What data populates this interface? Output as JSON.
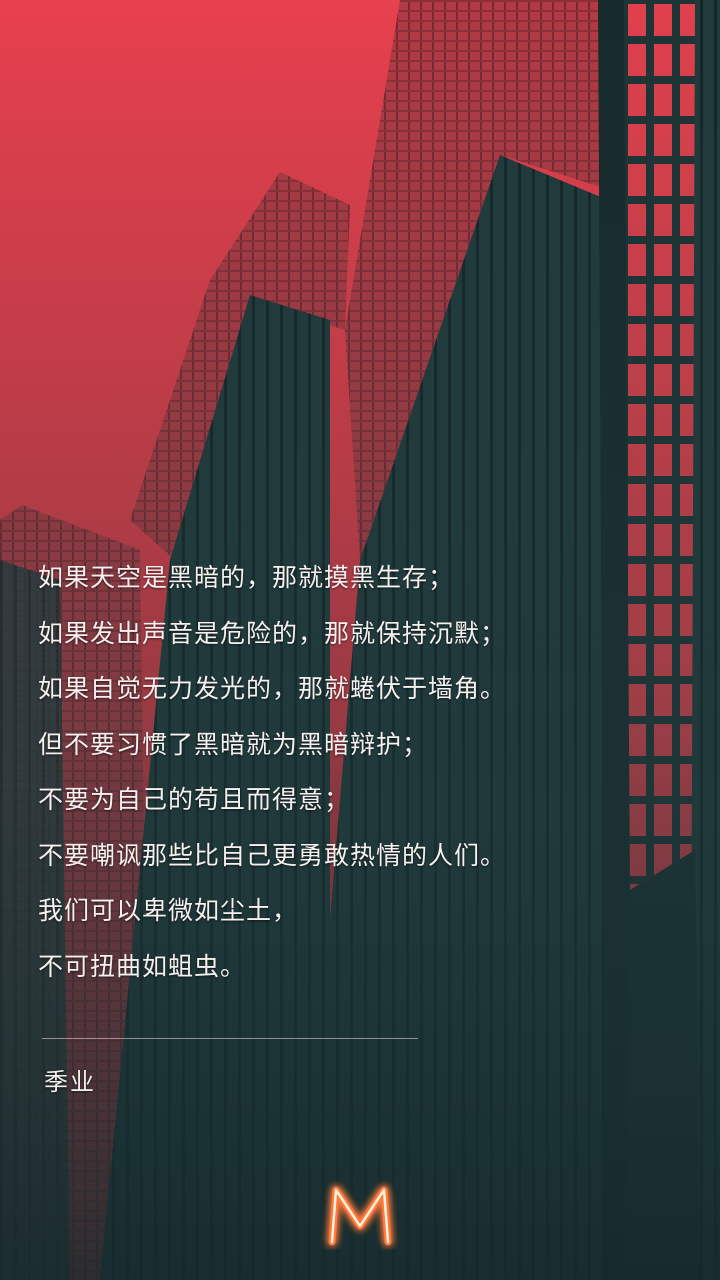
{
  "poem": {
    "lines": [
      "如果天空是黑暗的，那就摸黑生存；",
      "如果发出声音是危险的，那就保持沉默；",
      "如果自觉无力发光的，那就蜷伏于墙角。",
      "但不要习惯了黑暗就为黑暗辩护；",
      "不要为自己的苟且而得意；",
      "不要嘲讽那些比自己更勇敢热情的人们。",
      "我们可以卑微如尘土，",
      "不可扭曲如蛆虫。"
    ],
    "author": "季业"
  },
  "logo": {
    "letter": "M",
    "icon": "neon-m-logo-icon",
    "glow_color": "#ff7a3c"
  },
  "colors": {
    "sky": "#e8404e",
    "building_dark": "#1f3a3c",
    "building_red": "#a83540",
    "text": "#f6f0ef"
  }
}
